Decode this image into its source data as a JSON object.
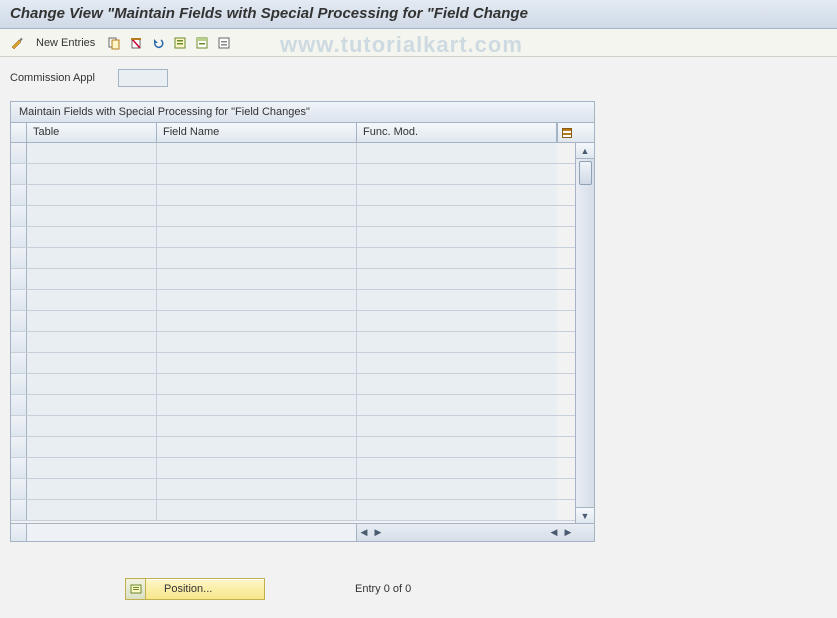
{
  "header": {
    "title": "Change View \"Maintain Fields with Special Processing for \"Field Change"
  },
  "toolbar": {
    "new_entries_label": "New Entries"
  },
  "form": {
    "commission_label": "Commission Appl",
    "commission_value": ""
  },
  "grid": {
    "title": "Maintain Fields with Special Processing for \"Field Changes\"",
    "columns": {
      "table": "Table",
      "field_name": "Field Name",
      "func_mod": "Func. Mod."
    },
    "rows": [
      {
        "table": "",
        "field": "",
        "func": ""
      },
      {
        "table": "",
        "field": "",
        "func": ""
      },
      {
        "table": "",
        "field": "",
        "func": ""
      },
      {
        "table": "",
        "field": "",
        "func": ""
      },
      {
        "table": "",
        "field": "",
        "func": ""
      },
      {
        "table": "",
        "field": "",
        "func": ""
      },
      {
        "table": "",
        "field": "",
        "func": ""
      },
      {
        "table": "",
        "field": "",
        "func": ""
      },
      {
        "table": "",
        "field": "",
        "func": ""
      },
      {
        "table": "",
        "field": "",
        "func": ""
      },
      {
        "table": "",
        "field": "",
        "func": ""
      },
      {
        "table": "",
        "field": "",
        "func": ""
      },
      {
        "table": "",
        "field": "",
        "func": ""
      },
      {
        "table": "",
        "field": "",
        "func": ""
      },
      {
        "table": "",
        "field": "",
        "func": ""
      },
      {
        "table": "",
        "field": "",
        "func": ""
      },
      {
        "table": "",
        "field": "",
        "func": ""
      },
      {
        "table": "",
        "field": "",
        "func": ""
      }
    ]
  },
  "footer": {
    "position_label": "Position...",
    "entry_text": "Entry 0 of 0"
  },
  "watermark": "www.tutorialkart.com"
}
